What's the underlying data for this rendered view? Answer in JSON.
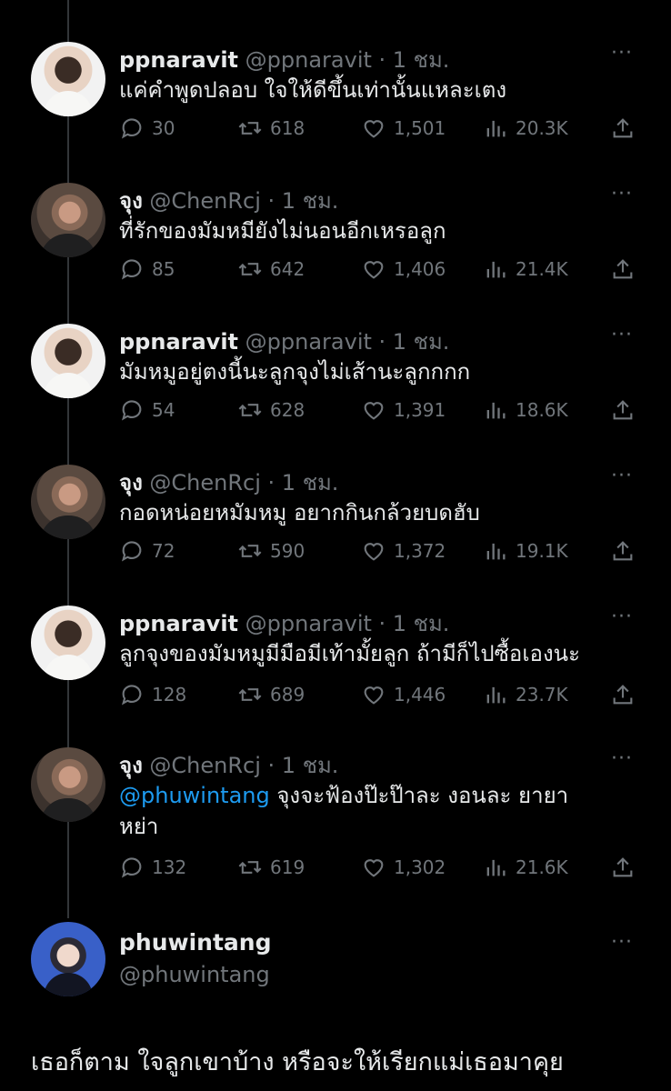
{
  "tweets": [
    {
      "name": "ppnaravit",
      "meta": "@ppnaravit · 1 ชม.",
      "text": "แค่คำพูดปลอบ ใจให้ดีขึ้นเท่านั้นแหละเตง",
      "replies": "30",
      "retweets": "618",
      "likes": "1,501",
      "views": "20.3K"
    },
    {
      "name": "จุง",
      "meta": "@ChenRcj · 1 ชม.",
      "text": "ที่รักของมัมหมียังไม่นอนอีกเหรอลูก",
      "replies": "85",
      "retweets": "642",
      "likes": "1,406",
      "views": "21.4K"
    },
    {
      "name": "ppnaravit",
      "meta": "@ppnaravit · 1 ชม.",
      "text": "มัมหมูอยู่ตงนี้นะลูกจุงไม่เส้านะลูกกกก",
      "replies": "54",
      "retweets": "628",
      "likes": "1,391",
      "views": "18.6K"
    },
    {
      "name": "จุง",
      "meta": "@ChenRcj · 1 ชม.",
      "text": "กอดหน่อยหมัมหมู อยากกินกล้วยบดฮับ",
      "replies": "72",
      "retweets": "590",
      "likes": "1,372",
      "views": "19.1K"
    },
    {
      "name": "ppnaravit",
      "meta": "@ppnaravit · 1 ชม.",
      "text": "ลูกจุงของมัมหมูมีมือมีเท้ามั้ยลูก ถ้ามีก็ไปซื้อเองนะ",
      "replies": "128",
      "retweets": "689",
      "likes": "1,446",
      "views": "23.7K"
    },
    {
      "name": "จุง",
      "meta": "@ChenRcj · 1 ชม.",
      "mention": "@phuwintang",
      "text": " จุงจะฟ้องป๊ะป๊าละ งอนละ ยายา หย่า",
      "replies": "132",
      "retweets": "619",
      "likes": "1,302",
      "views": "21.6K"
    }
  ],
  "final": {
    "name": "phuwintang",
    "handle": "@phuwintang",
    "text": "เธอก็ตาม ใจลูกเขาบ้าง หรือจะให้เรียกแม่เธอมาคุย"
  },
  "more_glyph": "···",
  "icons": {
    "reply": "reply-icon",
    "retweet": "retweet-icon",
    "like": "heart-icon",
    "views": "views-icon",
    "share": "share-icon"
  },
  "colors": {
    "background": "#000000",
    "text": "#e7e9ea",
    "muted": "#71767b",
    "mention": "#1d9bf0"
  }
}
